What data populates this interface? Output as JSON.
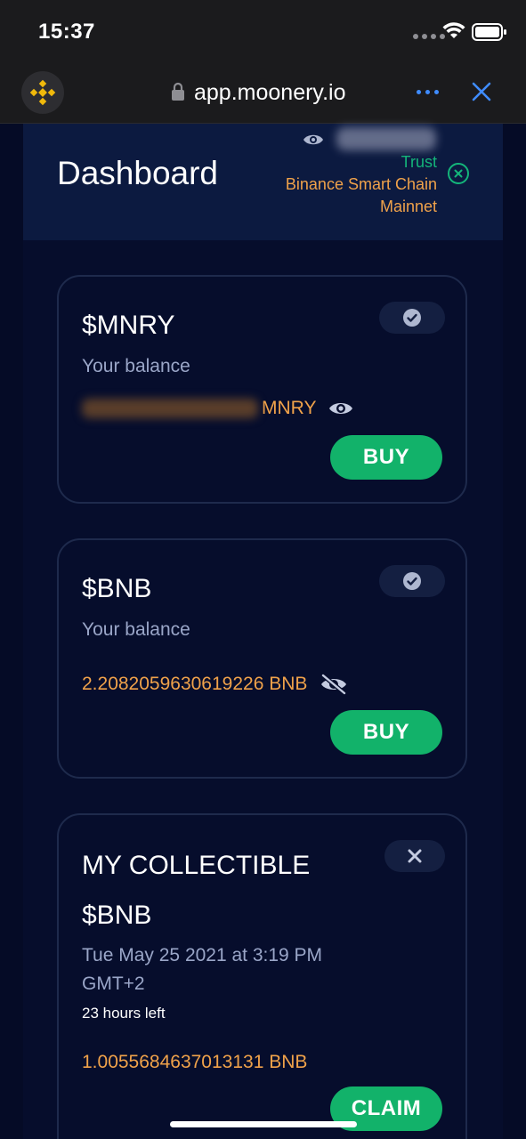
{
  "status_bar": {
    "time": "15:37"
  },
  "browser": {
    "url": "app.moonery.io"
  },
  "header": {
    "title": "Dashboard",
    "wallet_provider": "Trust",
    "network_line1": "Binance Smart Chain",
    "network_line2": "Mainnet"
  },
  "cards": [
    {
      "title": "$MNRY",
      "subtitle": "Your balance",
      "balance_unit": "MNRY",
      "button": "BUY"
    },
    {
      "title": "$BNB",
      "subtitle": "Your balance",
      "balance": "2.2082059630619226 BNB",
      "button": "BUY"
    },
    {
      "heading": "MY COLLECTIBLE",
      "title": "$BNB",
      "date_line1": "Tue May 25 2021 at 3:19 PM",
      "date_line2": "GMT+2",
      "time_left": "23 hours left",
      "balance": "1.0055684637013131 BNB",
      "button": "CLAIM"
    }
  ],
  "colors": {
    "background": "#050b26",
    "accent_green": "#12b26a",
    "accent_orange": "#f0a24a",
    "link_blue": "#3f8cff"
  },
  "icons": [
    "binance-logo-icon",
    "lock-icon",
    "more-icon",
    "close-icon",
    "eye-icon",
    "eye-off-icon",
    "check-circle-icon",
    "x-icon",
    "wifi-icon",
    "battery-icon"
  ]
}
